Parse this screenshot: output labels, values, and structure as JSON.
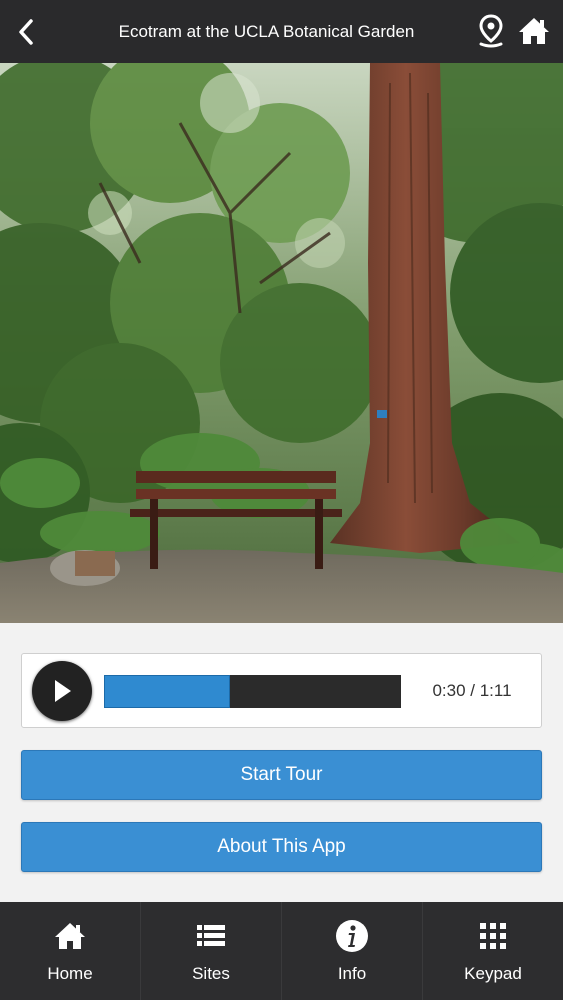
{
  "header": {
    "title": "Ecotram at the UCLA Botanical Garden",
    "back_icon": "chevron-left-icon",
    "location_icon": "map-pin-icon",
    "home_icon": "home-icon"
  },
  "hero": {
    "icon": "garden-photo"
  },
  "player": {
    "play_icon": "play-icon",
    "progress": 0.423,
    "time_text": "0:30 / 1:11"
  },
  "buttons": {
    "start_label": "Start Tour",
    "about_label": "About This App"
  },
  "tabs": [
    {
      "label": "Home",
      "icon": "home-icon"
    },
    {
      "label": "Sites",
      "icon": "list-icon"
    },
    {
      "label": "Info",
      "icon": "info-icon"
    },
    {
      "label": "Keypad",
      "icon": "keypad-icon"
    }
  ],
  "colors": {
    "header_bg": "#2a2a2c",
    "accent": "#3a8fd3",
    "tabbar_bg": "#2d2d2f",
    "progress_fill": "#2f8ad0"
  }
}
